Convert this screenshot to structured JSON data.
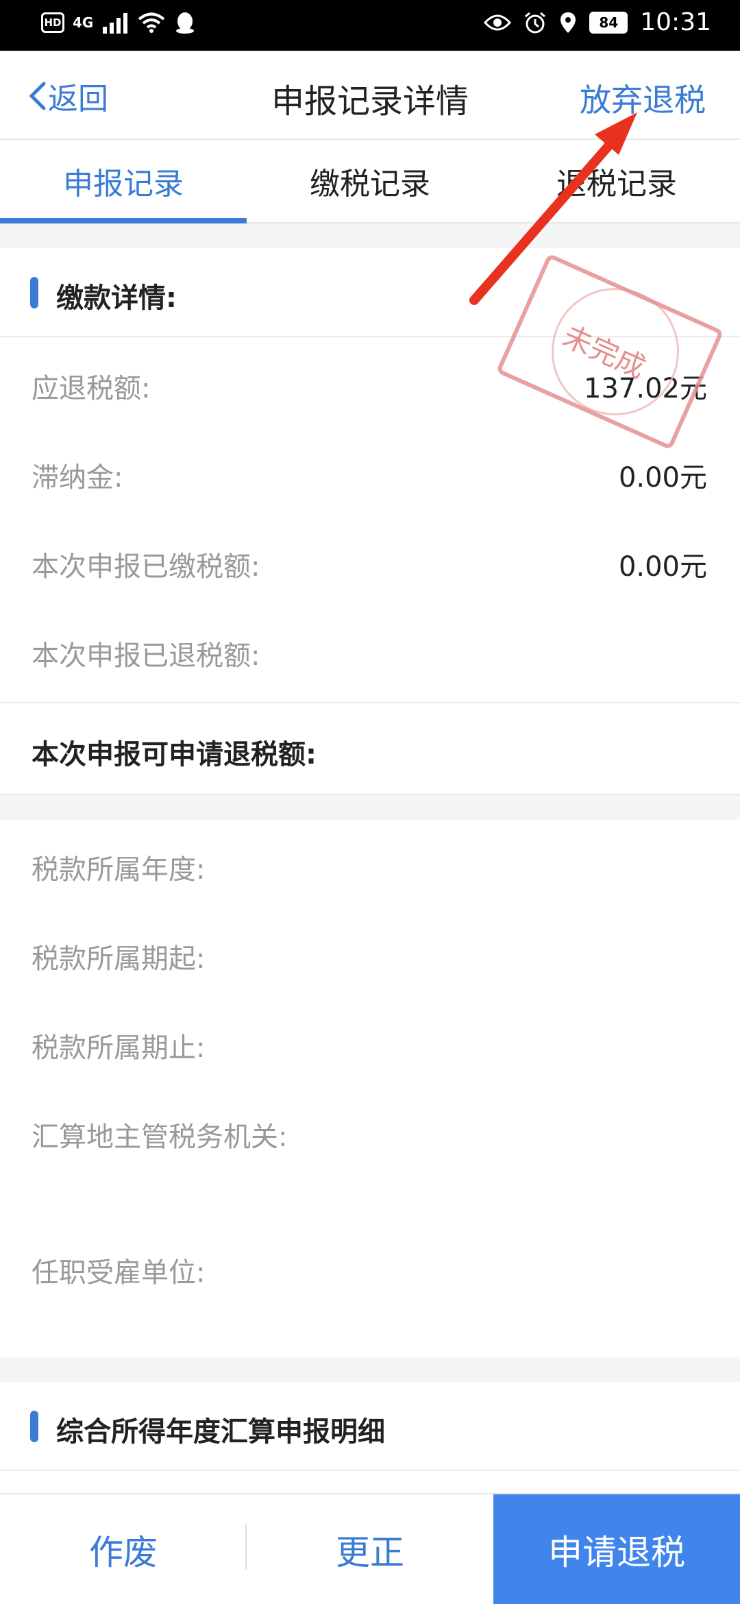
{
  "status_bar": {
    "left_icons": [
      "HD",
      "4G"
    ],
    "time": "10:31",
    "battery": "84"
  },
  "nav": {
    "back_label": "返回",
    "title": "申报记录详情",
    "action_label": "放弃退税"
  },
  "tabs": [
    {
      "label": "申报记录",
      "active": true
    },
    {
      "label": "缴税记录",
      "active": false
    },
    {
      "label": "退税记录",
      "active": false
    }
  ],
  "payment_section": {
    "title": "缴款详情:",
    "rows": [
      {
        "label": "应退税额:",
        "value": "137.02元"
      },
      {
        "label": "滞纳金:",
        "value": "0.00元"
      },
      {
        "label": "本次申报已缴税额:",
        "value": "0.00元"
      },
      {
        "label": "本次申报已退税额:",
        "value": ""
      }
    ],
    "highlight_label": "本次申报可申请退税额:",
    "detail_rows": [
      {
        "label": "税款所属年度:"
      },
      {
        "label": "税款所属期起:"
      },
      {
        "label": "税款所属期止:"
      },
      {
        "label": "汇算地主管税务机关:"
      },
      {
        "label": "任职受雇单位:"
      }
    ]
  },
  "stamp_text": "未完成",
  "summary_section": {
    "title": "综合所得年度汇算申报明细"
  },
  "bottom": {
    "void_label": "作废",
    "correct_label": "更正",
    "apply_refund_label": "申请退税"
  },
  "colors": {
    "accent": "#3a7bd5",
    "primary_button": "#3f85ec",
    "annotation_arrow": "#e8321f",
    "stamp": "#e58f8f"
  }
}
